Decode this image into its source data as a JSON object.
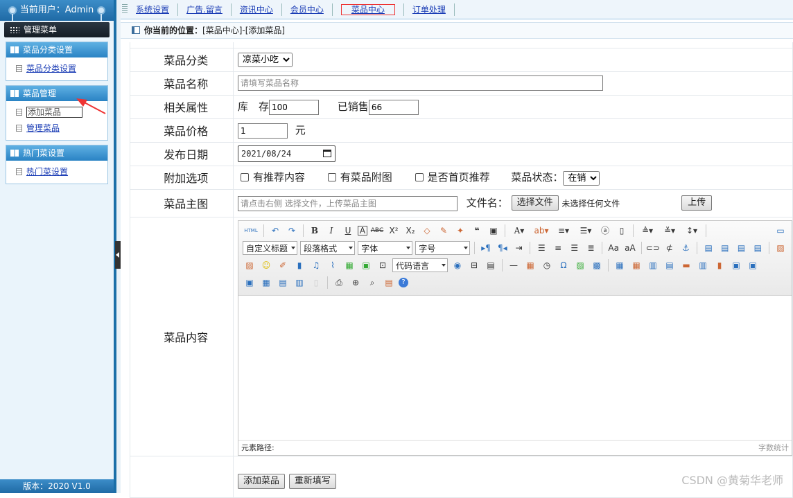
{
  "sidebar": {
    "user_label": "当前用户：Admin",
    "menu_title": "管理菜单",
    "groups": [
      {
        "title": "菜品分类设置",
        "items": [
          "菜品分类设置"
        ]
      },
      {
        "title": "菜品管理",
        "items": [
          "添加菜品",
          "管理菜品"
        ]
      },
      {
        "title": "热门菜设置",
        "items": [
          "热门菜设置"
        ]
      }
    ],
    "active_item": "添加菜品",
    "version": "版本：2020 V1.0"
  },
  "topnav": {
    "items": [
      "系统设置",
      "广告.留言",
      "资讯中心",
      "会员中心",
      "菜品中心",
      "订单处理"
    ],
    "selected": "菜品中心"
  },
  "breadcrumb": {
    "prefix": "你当前的位置：",
    "path": "[菜品中心]-[添加菜品]"
  },
  "form": {
    "category": {
      "label": "菜品分类",
      "value": "凉菜小吃"
    },
    "name": {
      "label": "菜品名称",
      "placeholder": "请填写菜品名称",
      "value": ""
    },
    "attrs": {
      "label": "相关属性",
      "stock_label": "库　存",
      "stock_value": "100",
      "sold_label": "已销售",
      "sold_value": "66"
    },
    "price": {
      "label": "菜品价格",
      "value": "1",
      "unit": "元"
    },
    "date": {
      "label": "发布日期",
      "value": "2021/08/24"
    },
    "options": {
      "label": "附加选项",
      "recommend": "有推荐内容",
      "attachment": "有菜品附图",
      "homepage": "是否首页推荐",
      "status_label": "菜品状态：",
      "status_value": "在销"
    },
    "image": {
      "label": "菜品主图",
      "placeholder": "请点击右侧 选择文件，上传菜品主图",
      "file_label": "文件名：",
      "choose_btn": "选择文件",
      "no_file": "未选择任何文件",
      "upload_btn": "上传"
    },
    "content": {
      "label": "菜品内容",
      "toolbar": {
        "html_btn": "HTML",
        "heading_select": "自定义标题",
        "paragraph_select": "段落格式",
        "font_select": "字体",
        "size_select": "字号",
        "code_select": "代码语言"
      },
      "footer_path": "元素路径:",
      "footer_count": "字数统计"
    },
    "submit_btn": "添加菜品",
    "reset_btn": "重新填写"
  },
  "watermark": "CSDN @黄菊华老师"
}
